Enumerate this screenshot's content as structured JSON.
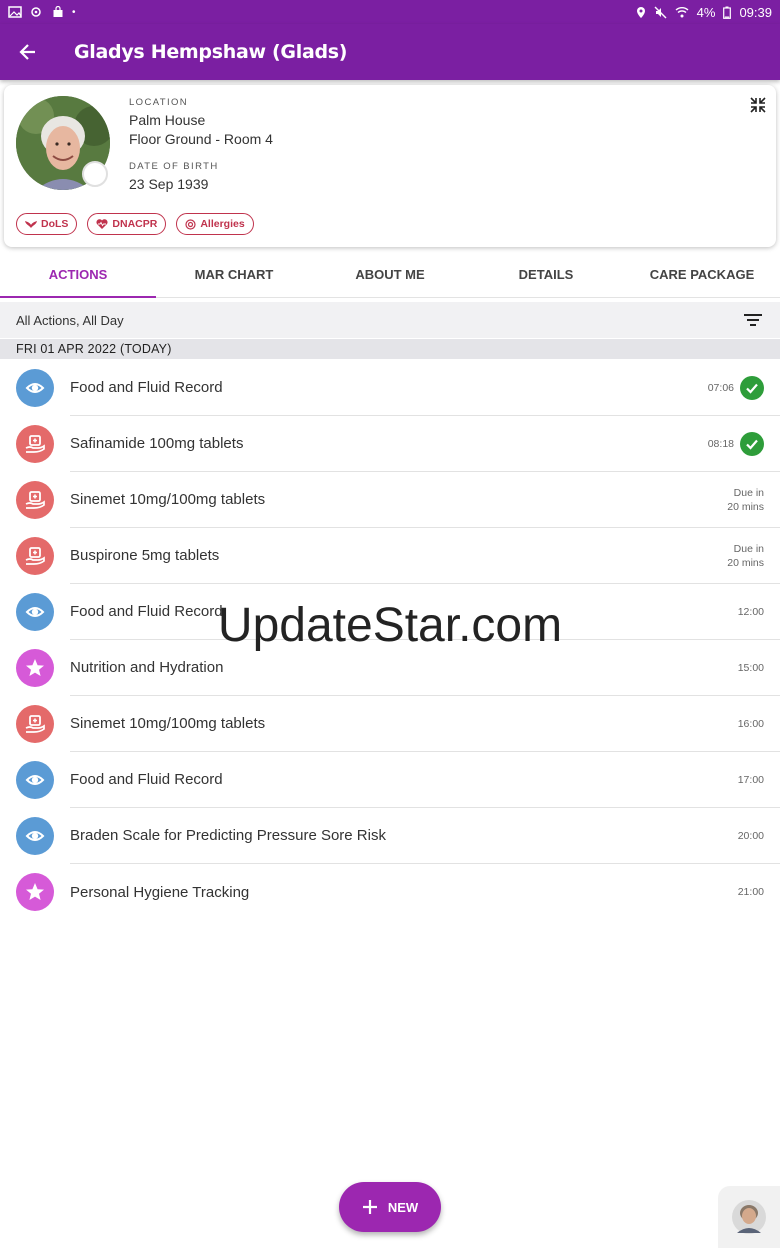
{
  "status_bar": {
    "battery": "4%",
    "time": "09:39"
  },
  "app_bar": {
    "title": "Gladys Hempshaw (Glads)"
  },
  "profile": {
    "location_label": "LOCATION",
    "location_line1": "Palm House",
    "location_line2": "Floor Ground - Room 4",
    "dob_label": "DATE OF BIRTH",
    "dob": "23 Sep 1939",
    "chips": [
      {
        "label": "DoLS",
        "icon": "wings-icon"
      },
      {
        "label": "DNACPR",
        "icon": "heart-icon"
      },
      {
        "label": "Allergies",
        "icon": "target-icon"
      }
    ]
  },
  "tabs": [
    {
      "label": "ACTIONS",
      "active": true
    },
    {
      "label": "MAR CHART",
      "active": false
    },
    {
      "label": "ABOUT ME",
      "active": false
    },
    {
      "label": "DETAILS",
      "active": false
    },
    {
      "label": "CARE PACKAGE",
      "active": false
    }
  ],
  "filter": {
    "label": "All Actions, All Day"
  },
  "date_header": "FRI 01 APR 2022 (TODAY)",
  "colors": {
    "brand": "#7b1fa2",
    "accent": "#9c27b0",
    "observation": "#5b9bd5",
    "medication": "#e46a6a",
    "custom": "#d65ad8",
    "done": "#2e9d3a"
  },
  "actions": [
    {
      "title": "Food and Fluid Record",
      "type": "observation",
      "icon": "eye-icon",
      "time": "07:06",
      "done": true
    },
    {
      "title": "Safinamide 100mg tablets",
      "type": "medication",
      "icon": "medical-hand-icon",
      "time": "08:18",
      "done": true
    },
    {
      "title": "Sinemet 10mg/100mg tablets",
      "type": "medication",
      "icon": "medical-hand-icon",
      "due_line1": "Due in",
      "due_line2": "20 mins"
    },
    {
      "title": "Buspirone 5mg tablets",
      "type": "medication",
      "icon": "medical-hand-icon",
      "due_line1": "Due in",
      "due_line2": "20 mins"
    },
    {
      "title": "Food and Fluid Record",
      "type": "observation",
      "icon": "eye-icon",
      "time": "12:00"
    },
    {
      "title": "Nutrition and Hydration",
      "type": "custom",
      "icon": "star-icon",
      "time": "15:00"
    },
    {
      "title": "Sinemet 10mg/100mg tablets",
      "type": "medication",
      "icon": "medical-hand-icon",
      "time": "16:00"
    },
    {
      "title": "Food and Fluid Record",
      "type": "observation",
      "icon": "eye-icon",
      "time": "17:00"
    },
    {
      "title": "Braden Scale for Predicting Pressure Sore Risk",
      "type": "observation",
      "icon": "eye-icon",
      "time": "20:00"
    },
    {
      "title": "Personal Hygiene Tracking",
      "type": "custom",
      "icon": "star-icon",
      "time": "21:00"
    }
  ],
  "watermark": "UpdateStar.com",
  "fab": {
    "label": "NEW"
  }
}
